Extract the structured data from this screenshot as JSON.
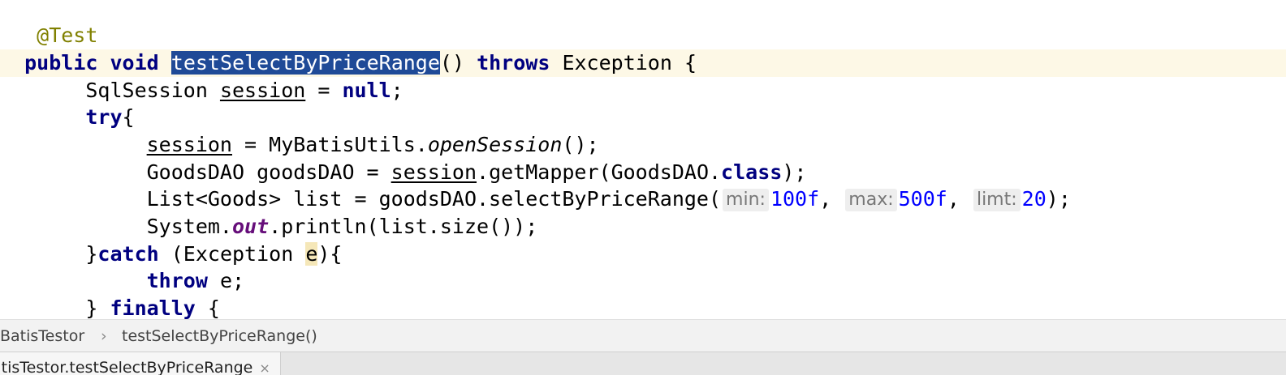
{
  "editor": {
    "lines": [
      {
        "text": "@Test"
      },
      {
        "kw_public": "public",
        "kw_void": "void",
        "method_name": "testSelectByPriceRange",
        "parens": "()",
        "kw_throws": "throws",
        "exception": "Exception {"
      },
      {
        "type": "SqlSession ",
        "var": "session",
        "assign": " = ",
        "kw_null": "null",
        "end": ";"
      },
      {
        "kw_try": "try",
        "brace": "{"
      },
      {
        "var": "session",
        "assign": " = MyBatisUtils.",
        "method": "openSession",
        "end": "();"
      },
      {
        "prefix": "GoodsDAO goodsDAO = ",
        "var": "session",
        "mid": ".getMapper(GoodsDAO.",
        "kw_class": "class",
        "end": ");"
      },
      {
        "prefix": "List<Goods> list = goodsDAO.selectByPriceRange(",
        "hint1": "min:",
        "num1": "100f",
        "sep1": ", ",
        "hint2": "max:",
        "num2": "500f",
        "sep2": ", ",
        "hint3": "limt:",
        "num3": "20",
        "end": ");"
      },
      {
        "prefix": "System.",
        "field": "out",
        "end": ".println(list.size());"
      },
      {
        "brace": "}",
        "kw_catch": "catch",
        "mid": " (Exception ",
        "var": "e",
        "end": "){"
      },
      {
        "kw_throw": "throw",
        "end": " e;"
      },
      {
        "brace": "} ",
        "kw_finally": "finally",
        "end": " {"
      }
    ]
  },
  "breadcrumb": {
    "items": [
      "BatisTestor",
      "testSelectByPriceRange()"
    ],
    "separator": "›"
  },
  "tabs": [
    {
      "label": "atisTestor.testSelectByPriceRange",
      "close": "×"
    }
  ],
  "colors": {
    "keyword": "#000080",
    "annotation": "#808000",
    "selection": "#1f4a97",
    "number": "#0000ff",
    "static_field": "#660e7a",
    "current_line": "#fdf8e6"
  }
}
